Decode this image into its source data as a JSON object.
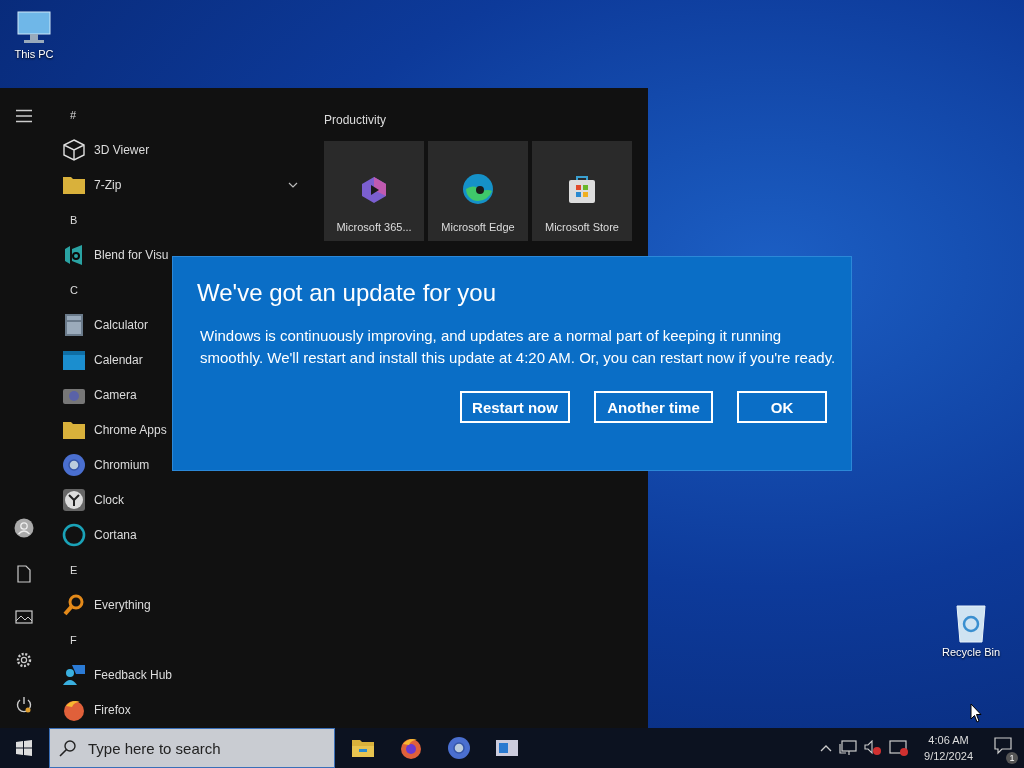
{
  "desktop_icons": [
    {
      "label": "This PC"
    },
    {
      "label": "Recycle Bin"
    }
  ],
  "start_menu": {
    "app_list": [
      {
        "kind": "letter",
        "label": "#"
      },
      {
        "kind": "app",
        "label": "3D Viewer"
      },
      {
        "kind": "app",
        "label": "7-Zip",
        "expanded": false
      },
      {
        "kind": "letter",
        "label": "B"
      },
      {
        "kind": "app",
        "label": "Blend for Visu"
      },
      {
        "kind": "letter",
        "label": "C"
      },
      {
        "kind": "app",
        "label": "Calculator"
      },
      {
        "kind": "app",
        "label": "Calendar"
      },
      {
        "kind": "app",
        "label": "Camera"
      },
      {
        "kind": "app",
        "label": "Chrome Apps"
      },
      {
        "kind": "app",
        "label": "Chromium"
      },
      {
        "kind": "app",
        "label": "Clock"
      },
      {
        "kind": "app",
        "label": "Cortana"
      },
      {
        "kind": "letter",
        "label": "E"
      },
      {
        "kind": "app",
        "label": "Everything"
      },
      {
        "kind": "letter",
        "label": "F"
      },
      {
        "kind": "app",
        "label": "Feedback Hub"
      },
      {
        "kind": "app",
        "label": "Firefox"
      }
    ],
    "tile_group": {
      "title": "Productivity",
      "tiles": [
        {
          "label": "Microsoft 365..."
        },
        {
          "label": "Microsoft Edge"
        },
        {
          "label": "Microsoft Store"
        }
      ]
    }
  },
  "dialog": {
    "title": "We've got an update for you",
    "message": "Windows is continuously improving, and updates are a normal part of keeping it running smoothly. We'll restart and install this update at 4:20 AM. Or, you can restart now if you're ready.",
    "buttons": [
      "Restart now",
      "Another time",
      "OK"
    ]
  },
  "taskbar": {
    "search": {
      "placeholder": "Type here to search"
    },
    "clock": {
      "time": "4:06 AM",
      "date": "9/12/2024"
    },
    "notification_count": "1"
  }
}
